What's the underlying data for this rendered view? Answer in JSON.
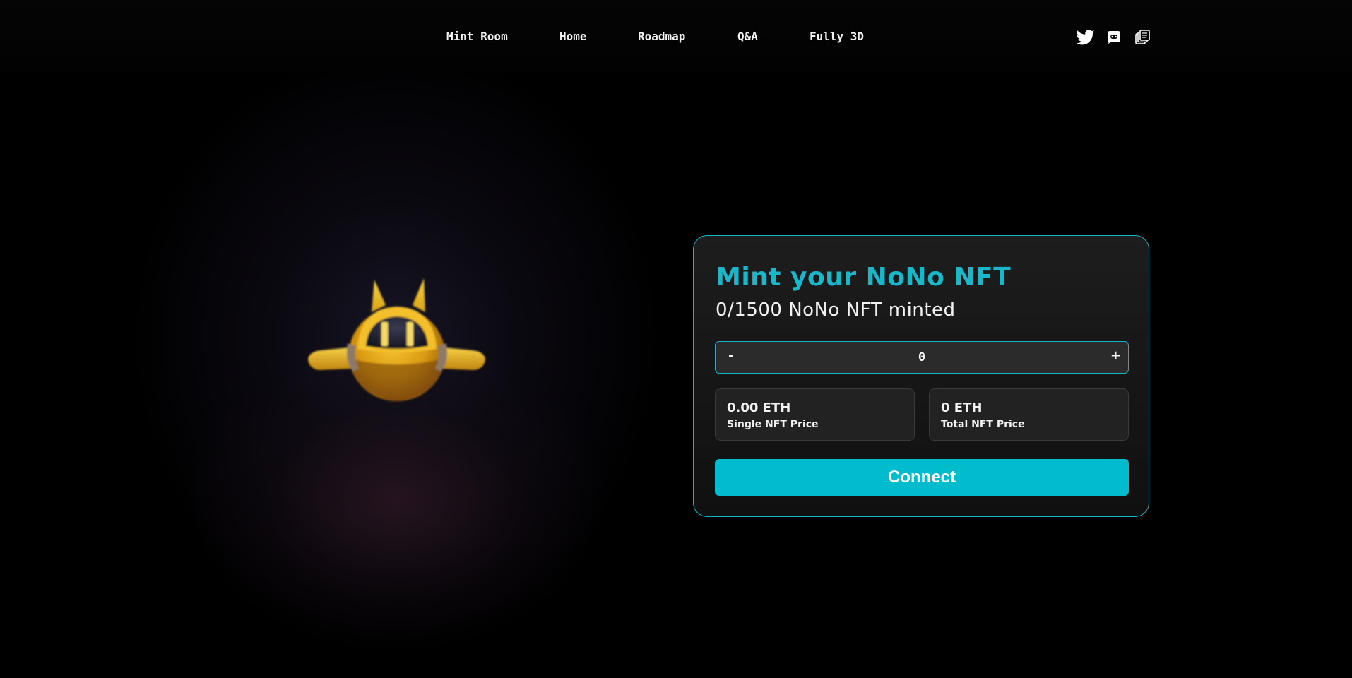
{
  "nav": {
    "links": [
      "Mint Room",
      "Home",
      "Roadmap",
      "Q&A",
      "Fully 3D"
    ],
    "social_icons": [
      "twitter-icon",
      "discord-icon",
      "opensea-icon"
    ]
  },
  "mint": {
    "title": "Mint your NoNo NFT",
    "minted_status": "0/1500 NoNo NFT minted",
    "stepper": {
      "minus_label": "-",
      "value": "0",
      "plus_label": "+"
    },
    "single_price": {
      "amount": "0.00 ETH",
      "label": "Single NFT Price"
    },
    "total_price": {
      "amount": "0 ETH",
      "label": "Total NFT Price"
    },
    "connect_label": "Connect"
  },
  "colors": {
    "accent": "#00bccd",
    "background": "#000000",
    "card": "#1a1a1a",
    "mascot": "#f2b71c"
  }
}
